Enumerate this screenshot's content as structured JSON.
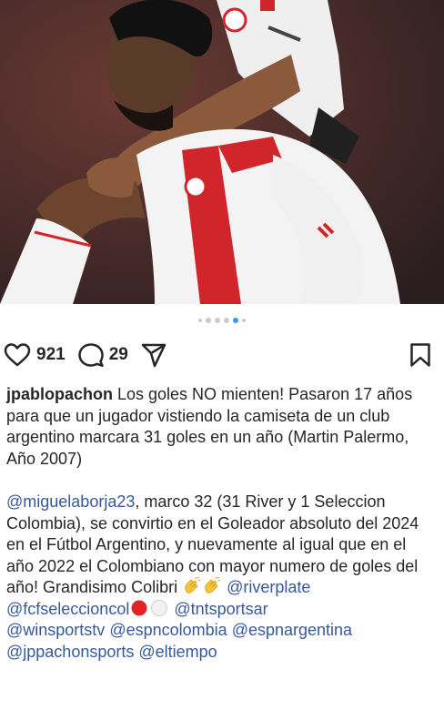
{
  "post": {
    "image": {
      "alt_icon": "post-photo-soccer-celebration"
    },
    "carousel": {
      "total": 6,
      "active_index": 3
    },
    "actions": {
      "like_icon": "heart-icon",
      "likes": "921",
      "comment_icon": "comment-icon",
      "comments": "29",
      "share_icon": "send-icon",
      "save_icon": "bookmark-icon"
    },
    "caption": {
      "username": "jpablopachon",
      "para1_text": " Los goles NO mienten! Pasaron 17 años para que un jugador vistiendo la camiseta de un club argentino marcara 31 goles en un año (Martin Palermo, Año 2007)",
      "mention_miguel": "@miguelaborja23",
      "para2_text": ", marco 32 (31 River y 1 Seleccion Colombia), se convirtio en el Goleador absoluto del 2024 en el Fútbol Argentino, y nuevamente al igual que en el año 2022 el Colombiano con mayor numero de goles del año! Grandisimo Colibri ",
      "mention_riverplate": "@riverplate",
      "mention_fcf": "@fcfseleccioncol",
      "mention_tnt": "@tntsportsar",
      "mention_winsports": "@winsportstv",
      "mention_espncolombia": "@espncolombia",
      "mention_espnargentina": "@espnargentina",
      "mention_jppachon": "@jppachonsports",
      "mention_eltiempo": "@eltiempo"
    },
    "colors": {
      "link": "#385898",
      "text": "#262626",
      "carousel_active": "#3897f0"
    }
  }
}
